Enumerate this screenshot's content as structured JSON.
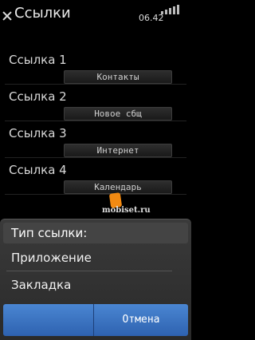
{
  "header": {
    "title": "Ссылки",
    "clock": "06.42"
  },
  "links": [
    {
      "label": "Ссылка 1",
      "value": "Контакты"
    },
    {
      "label": "Ссылка 2",
      "value": "Новое сбщ"
    },
    {
      "label": "Ссылка 3",
      "value": "Интернет"
    },
    {
      "label": "Ссылка 4",
      "value": "Календарь"
    }
  ],
  "watermark": {
    "text": "mobiset.ru"
  },
  "sheet": {
    "header": "Тип ссылки:",
    "options": [
      "Приложение",
      "Закладка"
    ],
    "cancel_label": "Отмена"
  }
}
